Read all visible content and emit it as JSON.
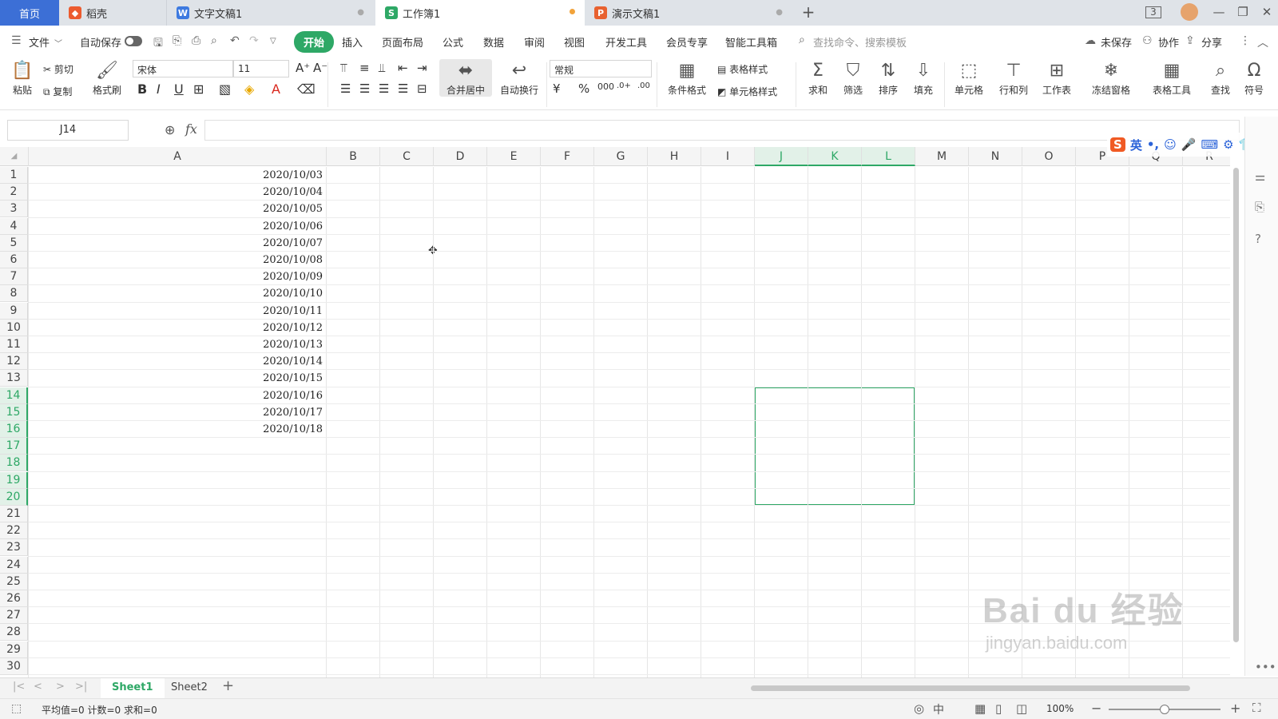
{
  "tabs": [
    {
      "label": "首页"
    },
    {
      "label": "稻壳"
    },
    {
      "label": "文字文稿1"
    },
    {
      "label": "工作簿1"
    },
    {
      "label": "演示文稿1"
    }
  ],
  "window": {
    "badge": "3"
  },
  "menu": {
    "file": "文件",
    "autosave": "自动保存",
    "items": [
      "开始",
      "插入",
      "页面布局",
      "公式",
      "数据",
      "审阅",
      "视图",
      "开发工具",
      "会员专享",
      "智能工具箱"
    ],
    "search_placeholder": "查找命令、搜索模板",
    "unsaved": "未保存",
    "collab": "协作",
    "share": "分享"
  },
  "ribbon": {
    "paste": "粘贴",
    "cut": "剪切",
    "copy": "复制",
    "format_painter": "格式刷",
    "font": "宋体",
    "font_size": "11",
    "merge_center": "合并居中",
    "wrap": "自动换行",
    "number_format": "常规",
    "cond_format": "条件格式",
    "table_style": "表格样式",
    "cell_style": "单元格样式",
    "sum": "求和",
    "filter": "筛选",
    "sort": "排序",
    "fill": "填充",
    "cell": "单元格",
    "rowcol": "行和列",
    "worksheet": "工作表",
    "freeze": "冻结窗格",
    "table_tools": "表格工具",
    "find": "查找",
    "symbol": "符号"
  },
  "formula_bar": {
    "name_box": "J14",
    "fx": "fx",
    "value": ""
  },
  "columns": [
    "A",
    "B",
    "C",
    "D",
    "E",
    "F",
    "G",
    "H",
    "I",
    "J",
    "K",
    "L",
    "M",
    "N",
    "O",
    "P",
    "Q",
    "R"
  ],
  "selected_columns": [
    "J",
    "K",
    "L"
  ],
  "rows": [
    1,
    2,
    3,
    4,
    5,
    6,
    7,
    8,
    9,
    10,
    11,
    12,
    13,
    14,
    15,
    16,
    17,
    18,
    19,
    20,
    21,
    22,
    23,
    24,
    25,
    26,
    27,
    28,
    29,
    30
  ],
  "selected_rows": [
    14,
    15,
    16,
    17,
    18,
    19,
    20
  ],
  "cells_A": [
    "2020/10/03",
    "2020/10/04",
    "2020/10/05",
    "2020/10/06",
    "2020/10/07",
    "2020/10/08",
    "2020/10/09",
    "2020/10/10",
    "2020/10/11",
    "2020/10/12",
    "2020/10/13",
    "2020/10/14",
    "2020/10/15",
    "2020/10/16",
    "2020/10/17",
    "2020/10/18"
  ],
  "sheets": {
    "sheet1": "Sheet1",
    "sheet2": "Sheet2"
  },
  "status": {
    "summary": "平均值=0 计数=0 求和=0",
    "zoom": "100%"
  },
  "ime": {
    "lang": "英"
  },
  "watermark": {
    "brand": "Bai du 经验",
    "url": "jingyan.baidu.com"
  },
  "colors": {
    "accent": "#2ea866",
    "home_tab": "#3c6fd6",
    "titlebar": "#dfe3e8"
  }
}
